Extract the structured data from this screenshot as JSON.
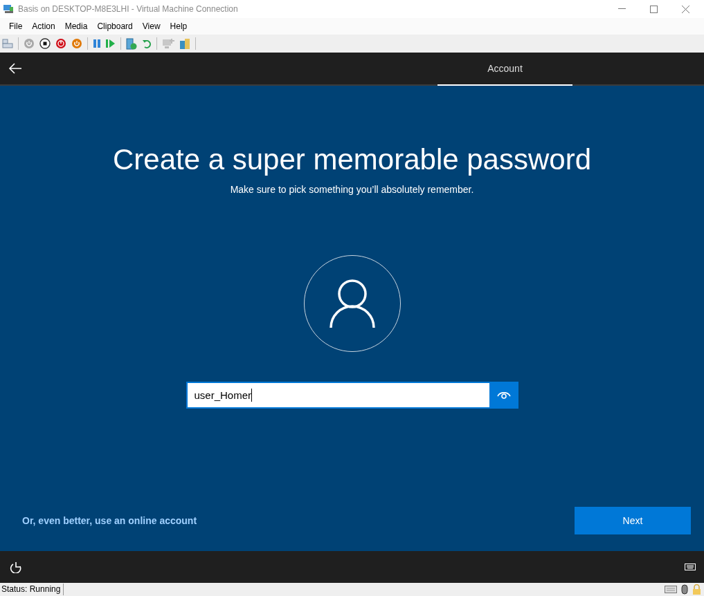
{
  "window": {
    "title": "Basis on DESKTOP-M8E3LHI - Virtual Machine Connection"
  },
  "menu": [
    "File",
    "Action",
    "Media",
    "Clipboard",
    "View",
    "Help"
  ],
  "header": {
    "tabs": [
      {
        "label": "Account",
        "selected": true
      }
    ]
  },
  "page": {
    "heading": "Create a super memorable password",
    "subheading": "Make sure to pick something you’ll absolutely remember.",
    "password": {
      "value": "user_Homer"
    },
    "link": "Or, even better, use an online account",
    "next": "Next"
  },
  "status_bar": {
    "status": "Status: Running"
  }
}
